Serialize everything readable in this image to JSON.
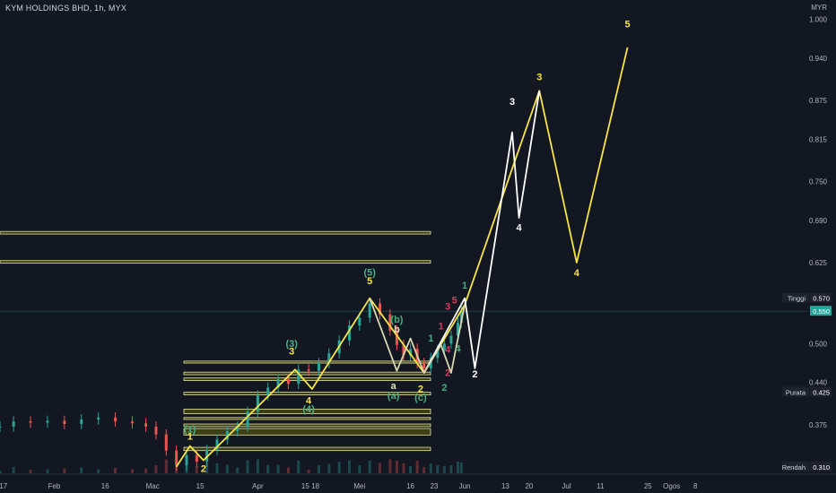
{
  "header": {
    "symbol_title": "KYM HOLDINGS BHD, 1h, MYX",
    "currency": "MYR"
  },
  "colors": {
    "background": "#131722",
    "wave_yellow": "#f7e447",
    "wave_white": "#ffffff",
    "label_green": "#4caf82",
    "label_red": "#d63a5c",
    "zone_fill": "#5a5a0e",
    "zone_border": "#e6e6a0",
    "axis_text": "#b2b5be"
  },
  "chart_data": {
    "type": "line",
    "title": "",
    "xlabel": "",
    "ylabel": "",
    "y_axis_label": "MYR",
    "ylim": [
      0.3,
      1.03
    ],
    "x_date_range": [
      "2024-01-16",
      "2024-09-10"
    ],
    "y_ticks": [
      "1.000",
      "0.940",
      "0.875",
      "0.815",
      "0.750",
      "0.690",
      "0.625",
      "0.500",
      "0.440",
      "0.375"
    ],
    "x_ticks": [
      {
        "label": "17",
        "date": "2024-01-17"
      },
      {
        "label": "Feb",
        "date": "2024-02-01"
      },
      {
        "label": "16",
        "date": "2024-02-16"
      },
      {
        "label": "Mac",
        "date": "2024-03-01"
      },
      {
        "label": "15",
        "date": "2024-03-15"
      },
      {
        "label": "Apr",
        "date": "2024-04-01"
      },
      {
        "label": "15",
        "date": "2024-04-15"
      },
      {
        "label": "18",
        "date": "2024-04-18"
      },
      {
        "label": "Mei",
        "date": "2024-05-01"
      },
      {
        "label": "16",
        "date": "2024-05-16"
      },
      {
        "label": "23",
        "date": "2024-05-23"
      },
      {
        "label": "Jun",
        "date": "2024-06-01"
      },
      {
        "label": "13",
        "date": "2024-06-13"
      },
      {
        "label": "20",
        "date": "2024-06-20"
      },
      {
        "label": "Jul",
        "date": "2024-07-01"
      },
      {
        "label": "11",
        "date": "2024-07-11"
      },
      {
        "label": "25",
        "date": "2024-07-25"
      },
      {
        "label": "Ogos",
        "date": "2024-08-01"
      },
      {
        "label": "8",
        "date": "2024-08-08"
      }
    ],
    "price_badges": [
      {
        "label": "Tinggi",
        "value": "0.570"
      },
      {
        "label": "",
        "value": "0.550"
      },
      {
        "label": "Purata",
        "value": "0.425"
      },
      {
        "label": "Rendah",
        "value": "0.310"
      }
    ],
    "current_price": 0.55,
    "resistance_zones": [
      [
        0.669,
        0.673
      ],
      [
        0.624,
        0.628
      ]
    ],
    "support_zones": [
      [
        0.47,
        0.473
      ],
      [
        0.452,
        0.456
      ],
      [
        0.443,
        0.447
      ],
      [
        0.421,
        0.425
      ],
      [
        0.392,
        0.399
      ],
      [
        0.383,
        0.386
      ],
      [
        0.372,
        0.376
      ],
      [
        0.359,
        0.369
      ],
      [
        0.335,
        0.34
      ]
    ],
    "series": [
      {
        "type": "candles",
        "points": [
          [
            "2024-01-16",
            0.372
          ],
          [
            "2024-01-20",
            0.38
          ],
          [
            "2024-01-25",
            0.378
          ],
          [
            "2024-01-30",
            0.381
          ],
          [
            "2024-02-04",
            0.376
          ],
          [
            "2024-02-09",
            0.383
          ],
          [
            "2024-02-14",
            0.386
          ],
          [
            "2024-02-19",
            0.38
          ],
          [
            "2024-02-24",
            0.377
          ],
          [
            "2024-02-28",
            0.372
          ],
          [
            "2024-03-02",
            0.36
          ],
          [
            "2024-03-05",
            0.335
          ],
          [
            "2024-03-08",
            0.312
          ],
          [
            "2024-03-11",
            0.328
          ],
          [
            "2024-03-14",
            0.318
          ],
          [
            "2024-03-17",
            0.336
          ],
          [
            "2024-03-20",
            0.352
          ],
          [
            "2024-03-23",
            0.365
          ],
          [
            "2024-03-26",
            0.372
          ],
          [
            "2024-03-29",
            0.395
          ],
          [
            "2024-04-01",
            0.42
          ],
          [
            "2024-04-04",
            0.432
          ],
          [
            "2024-04-07",
            0.445
          ],
          [
            "2024-04-10",
            0.438
          ],
          [
            "2024-04-13",
            0.46
          ],
          [
            "2024-04-16",
            0.458
          ],
          [
            "2024-04-19",
            0.47
          ],
          [
            "2024-04-22",
            0.485
          ],
          [
            "2024-04-25",
            0.505
          ],
          [
            "2024-04-28",
            0.528
          ],
          [
            "2024-05-01",
            0.54
          ],
          [
            "2024-05-04",
            0.562
          ],
          [
            "2024-05-07",
            0.545
          ],
          [
            "2024-05-10",
            0.52
          ],
          [
            "2024-05-12",
            0.498
          ],
          [
            "2024-05-14",
            0.482
          ],
          [
            "2024-05-16",
            0.492
          ],
          [
            "2024-05-18",
            0.47
          ],
          [
            "2024-05-20",
            0.462
          ],
          [
            "2024-05-22",
            0.478
          ],
          [
            "2024-05-24",
            0.49
          ],
          [
            "2024-05-26",
            0.5
          ],
          [
            "2024-05-28",
            0.512
          ],
          [
            "2024-05-30",
            0.532
          ],
          [
            "2024-05-31",
            0.55
          ]
        ]
      },
      {
        "name": "",
        "color": "#f7e447",
        "points": [
          [
            "2024-03-08",
            0.31
          ],
          [
            "2024-03-12",
            0.342
          ],
          [
            "2024-03-16",
            0.32
          ],
          [
            "2024-04-12",
            0.46
          ],
          [
            "2024-04-17",
            0.43
          ],
          [
            "2024-05-04",
            0.57
          ],
          [
            "2024-05-20",
            0.455
          ],
          [
            "2024-06-01",
            0.56
          ],
          [
            "2024-06-23",
            0.89
          ],
          [
            "2024-07-04",
            0.625
          ],
          [
            "2024-07-19",
            0.957
          ]
        ]
      },
      {
        "name": "",
        "color": "#ffffff",
        "points": [
          [
            "2024-05-20",
            0.455
          ],
          [
            "2024-06-01",
            0.57
          ],
          [
            "2024-06-04",
            0.462
          ],
          [
            "2024-06-15",
            0.826
          ],
          [
            "2024-06-17",
            0.694
          ],
          [
            "2024-06-23",
            0.89
          ]
        ]
      },
      {
        "name": "",
        "color": "#d8d8b0",
        "points": [
          [
            "2024-05-04",
            0.57
          ],
          [
            "2024-05-12",
            0.458
          ],
          [
            "2024-05-16",
            0.508
          ],
          [
            "2024-05-20",
            0.455
          ],
          [
            "2024-05-25",
            0.498
          ],
          [
            "2024-05-28",
            0.455
          ],
          [
            "2024-06-01",
            0.56
          ]
        ]
      }
    ],
    "annotations": [
      {
        "text": "(1)",
        "date": "2024-03-12",
        "price": 0.363,
        "color": "#4caf82"
      },
      {
        "text": "1",
        "date": "2024-03-12",
        "price": 0.352,
        "color": "#f7e447"
      },
      {
        "text": "2",
        "date": "2024-03-16",
        "price": 0.302,
        "color": "#f7e447"
      },
      {
        "text": "(3)",
        "date": "2024-04-11",
        "price": 0.495,
        "color": "#4caf82"
      },
      {
        "text": "3",
        "date": "2024-04-11",
        "price": 0.483,
        "color": "#f7e447"
      },
      {
        "text": "4",
        "date": "2024-04-16",
        "price": 0.407,
        "color": "#f7e447"
      },
      {
        "text": "(4)",
        "date": "2024-04-16",
        "price": 0.394,
        "color": "#4caf82"
      },
      {
        "text": "(5)",
        "date": "2024-05-04",
        "price": 0.605,
        "color": "#4caf82"
      },
      {
        "text": "5",
        "date": "2024-05-04",
        "price": 0.592,
        "color": "#f7e447"
      },
      {
        "text": "(b)",
        "date": "2024-05-12",
        "price": 0.532,
        "color": "#4caf82"
      },
      {
        "text": "b",
        "date": "2024-05-12",
        "price": 0.517,
        "color": "#e0e0c0"
      },
      {
        "text": "a",
        "date": "2024-05-11",
        "price": 0.43,
        "color": "#e0e0c0"
      },
      {
        "text": "(a)",
        "date": "2024-05-11",
        "price": 0.415,
        "color": "#4caf82"
      },
      {
        "text": "2",
        "date": "2024-05-19",
        "price": 0.425,
        "color": "#f7e447"
      },
      {
        "text": "(c)",
        "date": "2024-05-19",
        "price": 0.412,
        "color": "#4caf82"
      },
      {
        "text": "1",
        "date": "2024-05-22",
        "price": 0.503,
        "color": "#4caf82"
      },
      {
        "text": "2",
        "date": "2024-05-26",
        "price": 0.427,
        "color": "#4caf82"
      },
      {
        "text": "1",
        "date": "2024-05-25",
        "price": 0.522,
        "color": "#d63a5c"
      },
      {
        "text": "3",
        "date": "2024-05-27",
        "price": 0.552,
        "color": "#d63a5c"
      },
      {
        "text": "4",
        "date": "2024-05-27",
        "price": 0.486,
        "color": "#d63a5c"
      },
      {
        "text": "2",
        "date": "2024-05-27",
        "price": 0.45,
        "color": "#d63a5c"
      },
      {
        "text": "5",
        "date": "2024-05-29",
        "price": 0.562,
        "color": "#d63a5c"
      },
      {
        "text": "4",
        "date": "2024-05-30",
        "price": 0.487,
        "color": "#4caf82"
      },
      {
        "text": "1",
        "date": "2024-06-01",
        "price": 0.585,
        "color": "#4caf82"
      },
      {
        "text": "2",
        "date": "2024-06-04",
        "price": 0.448,
        "color": "#ffffff"
      },
      {
        "text": "3",
        "date": "2024-06-15",
        "price": 0.868,
        "color": "#ffffff"
      },
      {
        "text": "4",
        "date": "2024-06-17",
        "price": 0.674,
        "color": "#ffffff"
      },
      {
        "text": "3",
        "date": "2024-06-23",
        "price": 0.906,
        "color": "#f7e447"
      },
      {
        "text": "4",
        "date": "2024-07-04",
        "price": 0.604,
        "color": "#f7e447"
      },
      {
        "text": "5",
        "date": "2024-07-19",
        "price": 0.988,
        "color": "#f7e447"
      }
    ],
    "grid": false,
    "legend": "none"
  }
}
